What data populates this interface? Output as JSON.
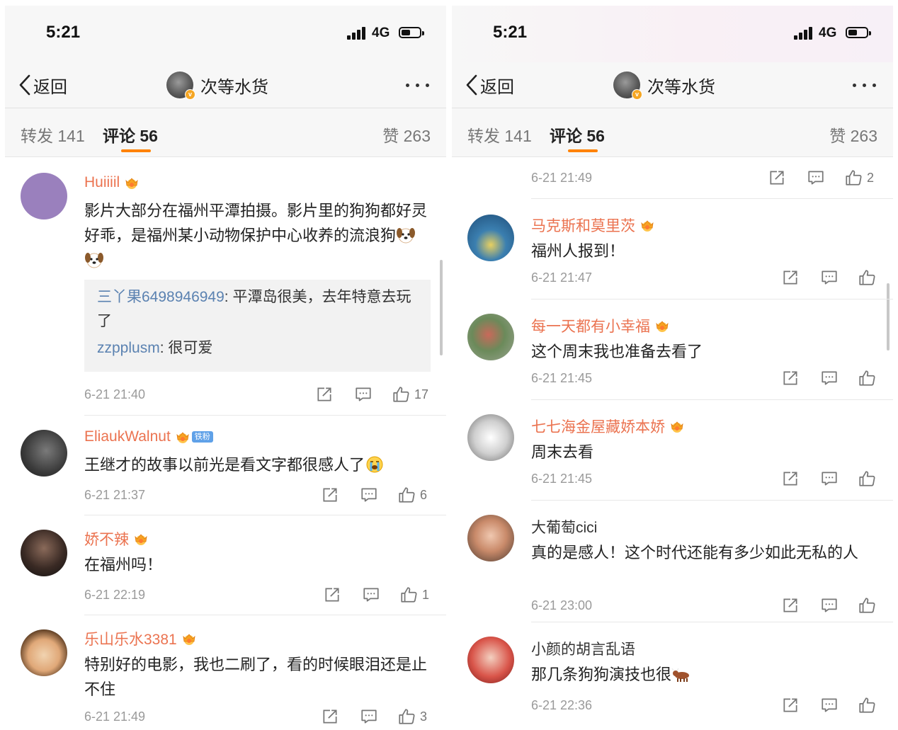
{
  "status": {
    "time": "5:21",
    "network": "4G"
  },
  "nav": {
    "back_label": "返回",
    "title": "次等水货"
  },
  "tabs": {
    "reposts": "转发 141",
    "comments": "评论 56",
    "likes": "赞 263"
  },
  "colors": {
    "accent": "#ff8200",
    "username": "#eb7350",
    "reply_name": "#5b82b1"
  },
  "left_comments": [
    {
      "user": "Huiiiil",
      "text": "影片大部分在福州平潭拍摄。影片里的狗狗都好灵好乖，是福州某小动物保护中心收养的流浪狗",
      "emoji": "dog-face",
      "time": "6-21 21:40",
      "likes": "17",
      "replies": [
        {
          "user": "三丫果6498946949",
          "text": ": 平潭岛很美，去年特意去玩了"
        },
        {
          "user": "zzpplusm",
          "text": ": 很可爱"
        }
      ]
    },
    {
      "user": "EliaukWalnut",
      "badge": "铁粉",
      "text": "王继才的故事以前光是看文字都很感人了",
      "emoji": "crying-face",
      "time": "6-21 21:37",
      "likes": "6"
    },
    {
      "user": "娇不辣",
      "text": "在福州吗！",
      "time": "6-21 22:19",
      "likes": "1"
    },
    {
      "user": "乐山乐水3381",
      "text": "特别好的电影，我也二刷了，看的时候眼泪还是止不住",
      "time": "6-21 21:49",
      "likes": "3"
    }
  ],
  "right_comments": [
    {
      "user": "",
      "text": "",
      "time": "6-21 21:49",
      "likes": "2"
    },
    {
      "user": "马克斯和莫里茨",
      "text": "福州人报到！",
      "time": "6-21 21:47",
      "likes": ""
    },
    {
      "user": "每一天都有小幸福",
      "text": "这个周末我也准备去看了",
      "time": "6-21 21:45",
      "likes": ""
    },
    {
      "user": "七七海金屋藏娇本娇",
      "text": "周末去看",
      "time": "6-21 21:45",
      "likes": ""
    },
    {
      "user": "大葡萄cici",
      "text": "真的是感人！这个时代还能有多少如此无私的人",
      "time": "6-21 23:00",
      "likes": ""
    },
    {
      "user": "小颜的胡言乱语",
      "text": "那几条狗狗演技也很",
      "emoji": "ox",
      "time": "6-21 22:36",
      "likes": ""
    }
  ]
}
